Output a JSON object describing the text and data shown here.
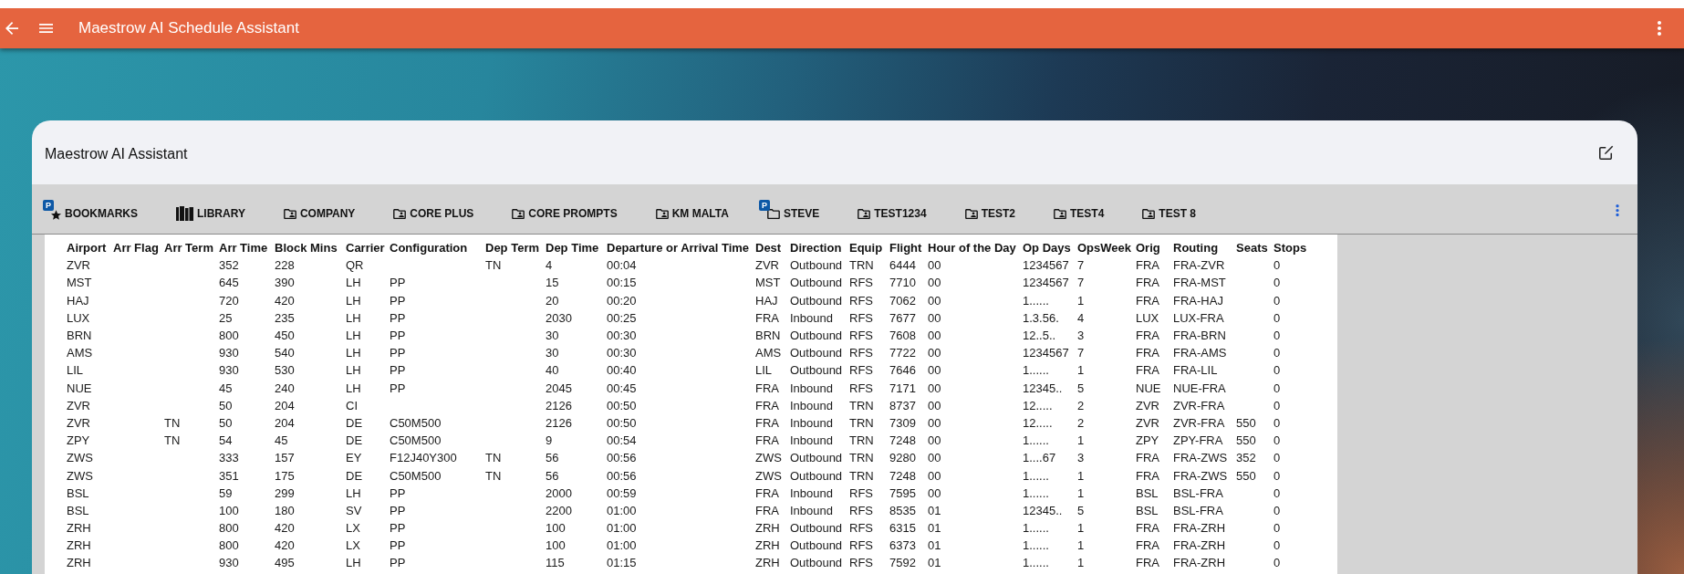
{
  "app_bar": {
    "title": "Maestrow AI Schedule Assistant"
  },
  "card": {
    "title": "Maestrow AI Assistant"
  },
  "toolbar": {
    "tabs": [
      {
        "label": "BOOKMARKS",
        "kind": "starred",
        "badge": "P"
      },
      {
        "label": "LIBRARY",
        "kind": "library"
      },
      {
        "label": "COMPANY",
        "kind": "shared-folder"
      },
      {
        "label": "CORE PLUS",
        "kind": "shared-folder"
      },
      {
        "label": "CORE PROMPTS",
        "kind": "shared-folder"
      },
      {
        "label": "KM MALTA",
        "kind": "shared-folder"
      },
      {
        "label": "STEVE",
        "kind": "folder",
        "badge": "P"
      },
      {
        "label": "TEST1234",
        "kind": "shared-folder"
      },
      {
        "label": "TEST2",
        "kind": "shared-folder"
      },
      {
        "label": "TEST4",
        "kind": "shared-folder"
      },
      {
        "label": "TEST 8",
        "kind": "shared-folder"
      }
    ]
  },
  "table": {
    "columns": [
      "Airport",
      "Arr Flag",
      "Arr Term",
      "Arr Time",
      "Block Mins",
      "Carrier",
      "Configuration",
      "Dep Term",
      "Dep Time",
      "Departure or Arrival Time",
      "Dest",
      "Direction",
      "Equip",
      "Flight",
      "Hour of the Day",
      "Op Days",
      "OpsWeek",
      "Orig",
      "Routing",
      "Seats",
      "Stops"
    ],
    "rows": [
      [
        "ZVR",
        null,
        null,
        "352",
        "228",
        "QR",
        null,
        "TN",
        "4",
        "00:04",
        "ZVR",
        "Outbound",
        "TRN",
        "6444",
        "00",
        "1234567",
        "7",
        "FRA",
        "FRA-ZVR",
        null,
        "0"
      ],
      [
        "MST",
        null,
        null,
        "645",
        "390",
        "LH",
        "PP",
        null,
        "15",
        "00:15",
        "MST",
        "Outbound",
        "RFS",
        "7710",
        "00",
        "1234567",
        "7",
        "FRA",
        "FRA-MST",
        null,
        "0"
      ],
      [
        "HAJ",
        null,
        null,
        "720",
        "420",
        "LH",
        "PP",
        null,
        "20",
        "00:20",
        "HAJ",
        "Outbound",
        "RFS",
        "7062",
        "00",
        "1......",
        "1",
        "FRA",
        "FRA-HAJ",
        null,
        "0"
      ],
      [
        "LUX",
        null,
        null,
        "25",
        "235",
        "LH",
        "PP",
        null,
        "2030",
        "00:25",
        "FRA",
        "Inbound",
        "RFS",
        "7677",
        "00",
        "1.3.56.",
        "4",
        "LUX",
        "LUX-FRA",
        null,
        "0"
      ],
      [
        "BRN",
        null,
        null,
        "800",
        "450",
        "LH",
        "PP",
        null,
        "30",
        "00:30",
        "BRN",
        "Outbound",
        "RFS",
        "7608",
        "00",
        "12..5..",
        "3",
        "FRA",
        "FRA-BRN",
        null,
        "0"
      ],
      [
        "AMS",
        null,
        null,
        "930",
        "540",
        "LH",
        "PP",
        null,
        "30",
        "00:30",
        "AMS",
        "Outbound",
        "RFS",
        "7722",
        "00",
        "1234567",
        "7",
        "FRA",
        "FRA-AMS",
        null,
        "0"
      ],
      [
        "LIL",
        null,
        null,
        "930",
        "530",
        "LH",
        "PP",
        null,
        "40",
        "00:40",
        "LIL",
        "Outbound",
        "RFS",
        "7646",
        "00",
        "1......",
        "1",
        "FRA",
        "FRA-LIL",
        null,
        "0"
      ],
      [
        "NUE",
        null,
        null,
        "45",
        "240",
        "LH",
        "PP",
        null,
        "2045",
        "00:45",
        "FRA",
        "Inbound",
        "RFS",
        "7171",
        "00",
        "12345..",
        "5",
        "NUE",
        "NUE-FRA",
        null,
        "0"
      ],
      [
        "ZVR",
        null,
        null,
        "50",
        "204",
        "CI",
        null,
        null,
        "2126",
        "00:50",
        "FRA",
        "Inbound",
        "TRN",
        "8737",
        "00",
        "12.....",
        "2",
        "ZVR",
        "ZVR-FRA",
        null,
        "0"
      ],
      [
        "ZVR",
        null,
        "TN",
        "50",
        "204",
        "DE",
        "C50M500",
        null,
        "2126",
        "00:50",
        "FRA",
        "Inbound",
        "TRN",
        "7309",
        "00",
        "12.....",
        "2",
        "ZVR",
        "ZVR-FRA",
        "550",
        "0"
      ],
      [
        "ZPY",
        null,
        "TN",
        "54",
        "45",
        "DE",
        "C50M500",
        null,
        "9",
        "00:54",
        "FRA",
        "Inbound",
        "TRN",
        "7248",
        "00",
        "1......",
        "1",
        "ZPY",
        "ZPY-FRA",
        "550",
        "0"
      ],
      [
        "ZWS",
        null,
        null,
        "333",
        "157",
        "EY",
        "F12J40Y300",
        "TN",
        "56",
        "00:56",
        "ZWS",
        "Outbound",
        "TRN",
        "9280",
        "00",
        "1....67",
        "3",
        "FRA",
        "FRA-ZWS",
        "352",
        "0"
      ],
      [
        "ZWS",
        null,
        null,
        "351",
        "175",
        "DE",
        "C50M500",
        "TN",
        "56",
        "00:56",
        "ZWS",
        "Outbound",
        "TRN",
        "7248",
        "00",
        "1......",
        "1",
        "FRA",
        "FRA-ZWS",
        "550",
        "0"
      ],
      [
        "BSL",
        null,
        null,
        "59",
        "299",
        "LH",
        "PP",
        null,
        "2000",
        "00:59",
        "FRA",
        "Inbound",
        "RFS",
        "7595",
        "00",
        "1......",
        "1",
        "BSL",
        "BSL-FRA",
        null,
        "0"
      ],
      [
        "BSL",
        null,
        null,
        "100",
        "180",
        "SV",
        "PP",
        null,
        "2200",
        "01:00",
        "FRA",
        "Inbound",
        "RFS",
        "8535",
        "01",
        "12345..",
        "5",
        "BSL",
        "BSL-FRA",
        null,
        "0"
      ],
      [
        "ZRH",
        null,
        null,
        "800",
        "420",
        "LX",
        "PP",
        null,
        "100",
        "01:00",
        "ZRH",
        "Outbound",
        "RFS",
        "6315",
        "01",
        "1......",
        "1",
        "FRA",
        "FRA-ZRH",
        null,
        "0"
      ],
      [
        "ZRH",
        null,
        null,
        "800",
        "420",
        "LX",
        "PP",
        null,
        "100",
        "01:00",
        "ZRH",
        "Outbound",
        "RFS",
        "6373",
        "01",
        "1......",
        "1",
        "FRA",
        "FRA-ZRH",
        null,
        "0"
      ],
      [
        "ZRH",
        null,
        null,
        "930",
        "495",
        "LH",
        "PP",
        null,
        "115",
        "01:15",
        "ZRH",
        "Outbound",
        "RFS",
        "7592",
        "01",
        "1......",
        "1",
        "FRA",
        "FRA-ZRH",
        null,
        "0"
      ]
    ]
  }
}
